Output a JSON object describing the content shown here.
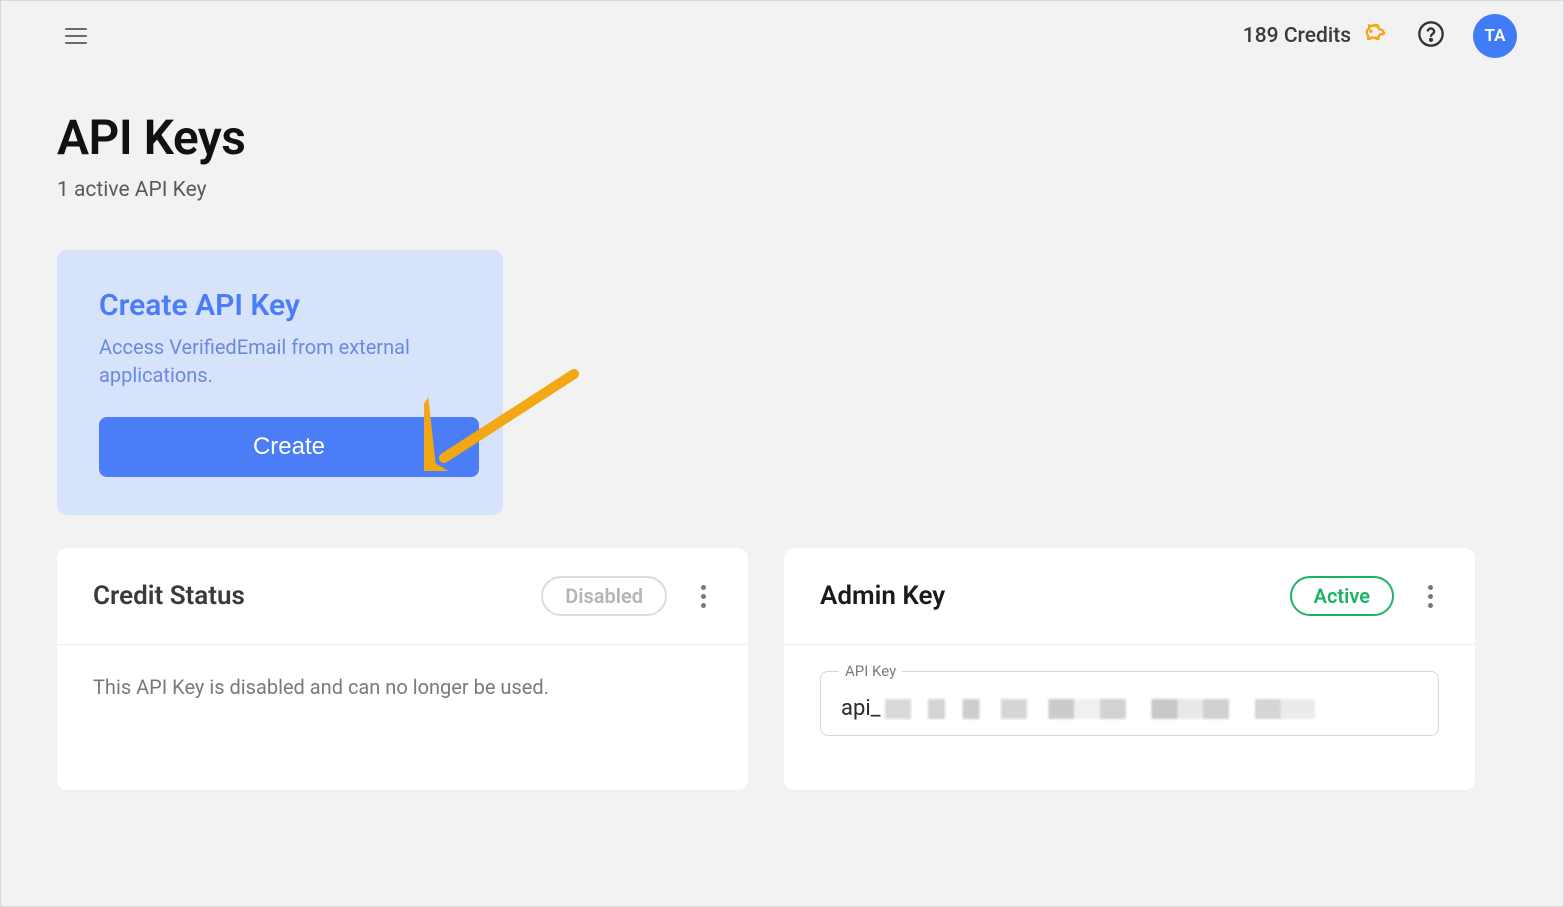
{
  "header": {
    "credits_text": "189 Credits",
    "avatar_initials": "TA"
  },
  "page": {
    "title": "API Keys",
    "subtitle": "1 active API Key"
  },
  "create_panel": {
    "title": "Create API Key",
    "description": "Access VerifiedEmail from external applications.",
    "button_label": "Create"
  },
  "cards": {
    "credit_status": {
      "title": "Credit Status",
      "badge": "Disabled",
      "body": "This API Key is disabled and can no longer be used."
    },
    "admin_key": {
      "title": "Admin Key",
      "badge": "Active",
      "field_label": "API Key",
      "value_prefix": "api_"
    }
  }
}
